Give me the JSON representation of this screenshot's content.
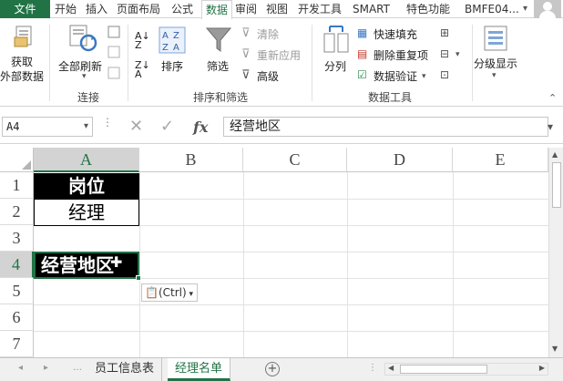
{
  "menu": {
    "file": "文件",
    "tabs": [
      "开始",
      "插入",
      "页面布局",
      "公式",
      "数据",
      "审阅",
      "视图",
      "开发工具",
      "SMART",
      "特色功能",
      "BMFE04..."
    ],
    "active_tab": "数据"
  },
  "ribbon": {
    "get_external": [
      "获取",
      "外部数据"
    ],
    "refresh_all": "全部刷新",
    "connections_group": "连接",
    "sort": "排序",
    "filter": "筛选",
    "clear": "清除",
    "reapply": "重新应用",
    "advanced": "高级",
    "sort_filter_group": "排序和筛选",
    "text_to_columns": "分列",
    "flash_fill": "快速填充",
    "remove_duplicates": "删除重复项",
    "data_validation": "数据验证",
    "data_tools_group": "数据工具",
    "outline": "分级显示"
  },
  "formula_bar": {
    "name_box": "A4",
    "content": "经营地区",
    "fx": "fx"
  },
  "grid": {
    "columns": [
      "A",
      "B",
      "C",
      "D",
      "E"
    ],
    "rows": [
      "1",
      "2",
      "3",
      "4",
      "5",
      "6",
      "7"
    ],
    "cells": {
      "A1": "岗位",
      "A2": "经理",
      "A4": "经营地区"
    },
    "selected_cell": "A4",
    "paste_options": "(Ctrl)"
  },
  "sheets": {
    "tabs": [
      "员工信息表",
      "经理名单"
    ],
    "active": "经理名单"
  },
  "colors": {
    "accent": "#217346",
    "selected_header_bg": "#d3d3d3"
  }
}
